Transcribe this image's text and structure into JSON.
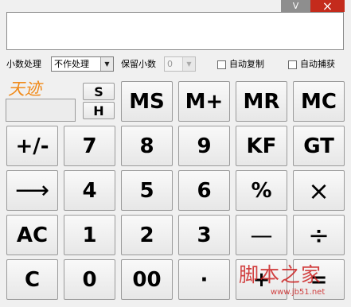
{
  "window": {
    "minimize_glyph": "V",
    "close_glyph": "×"
  },
  "display": {
    "value": ""
  },
  "options": {
    "decimal_label": "小数处理",
    "decimal_mode": "不作处理",
    "keep_label": "保留小数",
    "keep_value": "0",
    "auto_copy_label": "自动复制",
    "auto_capture_label": "自动捕获"
  },
  "brand": {
    "text": "天迹"
  },
  "keys": {
    "s": "S",
    "h": "H",
    "ms": "MS",
    "mplus": "M+",
    "mr": "MR",
    "mc": "MC",
    "sign": "+/-",
    "seven": "7",
    "eight": "8",
    "nine": "9",
    "kf": "KF",
    "gt": "GT",
    "backspace": "⟶",
    "four": "4",
    "five": "5",
    "six": "6",
    "percent": "%",
    "multiply": "×",
    "ac": "AC",
    "one": "1",
    "two": "2",
    "three": "3",
    "minus": "—",
    "divide": "÷",
    "clear": "C",
    "zero": "0",
    "double_zero": "00",
    "dot": "·",
    "plus": "+",
    "equals": "="
  },
  "watermark": {
    "line1": "脚本之家",
    "line2": "www.jb51.net"
  },
  "colors": {
    "close_bg": "#c42b1c",
    "min_bg": "#8e8e8e",
    "brand": "#f08a1a",
    "watermark": "#cc2222"
  }
}
